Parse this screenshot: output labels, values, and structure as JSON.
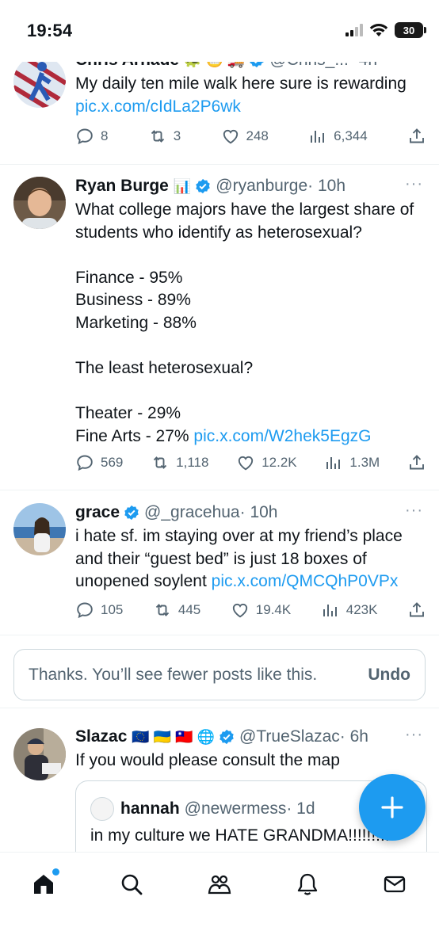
{
  "status_bar": {
    "time": "19:54",
    "battery": "30"
  },
  "tweets": [
    {
      "name": "Chris Arnade",
      "emojis": "🐢 😬 🚚",
      "handle": "@Chris_...",
      "time": "· 4h",
      "text": "My daily ten mile walk here sure is rewarding",
      "link": "pic.x.com/cIdLa2P6wk",
      "replies": "8",
      "reposts": "3",
      "likes": "248",
      "views": "6,344"
    },
    {
      "name": "Ryan Burge",
      "emojis": "📊",
      "handle": "@ryanburge",
      "time": "· 10h",
      "text": "What college majors have the largest share of students who identify as heterosexual?\n\nFinance - 95%\nBusiness - 89%\nMarketing  - 88%\n\nThe least heterosexual?\n\nTheater - 29%\nFine Arts - 27% ",
      "link": "pic.x.com/W2hek5EgzG",
      "replies": "569",
      "reposts": "1,118",
      "likes": "12.2K",
      "views": "1.3M"
    },
    {
      "name": "grace",
      "handle": "@_gracehua",
      "time": "· 10h",
      "text": "i hate sf. im staying over at my friend’s place and their “guest bed” is just 18 boxes of unopened soylent ",
      "link": "pic.x.com/QMCQhP0VPx",
      "replies": "105",
      "reposts": "445",
      "likes": "19.4K",
      "views": "423K"
    },
    {
      "name": "Slazac",
      "emojis": "🇪🇺 🇺🇦 🇹🇼 🌐",
      "handle": "@TrueSlazac",
      "time": "· 6h",
      "text": "If you would please consult the map",
      "quote": {
        "name": "hannah",
        "handle": "@newermess",
        "time": "· 1d",
        "text": "in my culture we HATE GRANDMA!!!!!!!!!"
      }
    }
  ],
  "feedback": {
    "text": "Thanks. You’ll see fewer posts like this.",
    "undo": "Undo"
  },
  "more_label": "···",
  "colors": {
    "accent": "#1d9bf0",
    "muted": "#536471",
    "text": "#0f1419"
  }
}
